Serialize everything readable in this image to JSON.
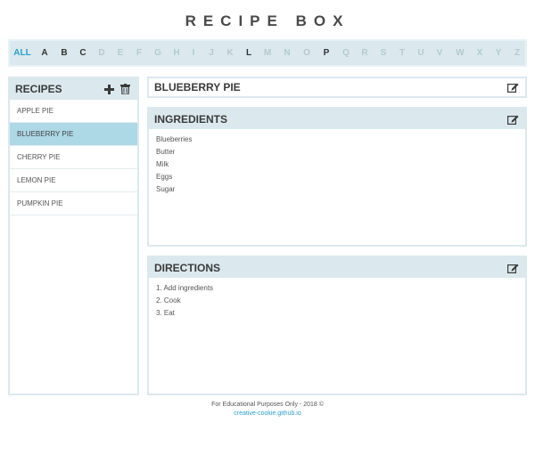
{
  "app": {
    "title": "RECIPE BOX"
  },
  "alphabet": {
    "items": [
      {
        "label": "ALL",
        "state": "active"
      },
      {
        "label": "A",
        "state": "has"
      },
      {
        "label": "B",
        "state": "has"
      },
      {
        "label": "C",
        "state": "has"
      },
      {
        "label": "D",
        "state": "empty"
      },
      {
        "label": "E",
        "state": "empty"
      },
      {
        "label": "F",
        "state": "empty"
      },
      {
        "label": "G",
        "state": "empty"
      },
      {
        "label": "H",
        "state": "empty"
      },
      {
        "label": "I",
        "state": "empty"
      },
      {
        "label": "J",
        "state": "empty"
      },
      {
        "label": "K",
        "state": "empty"
      },
      {
        "label": "L",
        "state": "has"
      },
      {
        "label": "M",
        "state": "empty"
      },
      {
        "label": "N",
        "state": "empty"
      },
      {
        "label": "O",
        "state": "empty"
      },
      {
        "label": "P",
        "state": "has"
      },
      {
        "label": "Q",
        "state": "empty"
      },
      {
        "label": "R",
        "state": "empty"
      },
      {
        "label": "S",
        "state": "empty"
      },
      {
        "label": "T",
        "state": "empty"
      },
      {
        "label": "U",
        "state": "empty"
      },
      {
        "label": "V",
        "state": "empty"
      },
      {
        "label": "W",
        "state": "empty"
      },
      {
        "label": "X",
        "state": "empty"
      },
      {
        "label": "Y",
        "state": "empty"
      },
      {
        "label": "Z",
        "state": "empty"
      }
    ]
  },
  "recipes": {
    "header": "RECIPES",
    "add_icon": "plus-icon",
    "delete_icon": "trash-icon",
    "items": [
      {
        "label": "APPLE PIE",
        "selected": false
      },
      {
        "label": "BLUEBERRY PIE",
        "selected": true
      },
      {
        "label": "CHERRY PIE",
        "selected": false
      },
      {
        "label": "LEMON PIE",
        "selected": false
      },
      {
        "label": "PUMPKIN PIE",
        "selected": false
      }
    ]
  },
  "recipe": {
    "title": "BLUEBERRY PIE",
    "ingredients": {
      "header": "INGREDIENTS",
      "items": [
        "Blueberries",
        "Butter",
        "Milk",
        "Eggs",
        "Sugar"
      ]
    },
    "directions": {
      "header": "DIRECTIONS",
      "items": [
        "1. Add ingredients",
        "2. Cook",
        "3. Eat"
      ]
    }
  },
  "footer": {
    "text": "For Educational Purposes Only - 2018 ©",
    "link": "creative-cookie.github.io"
  },
  "colors": {
    "header_bg": "#dbe9ee",
    "selected_bg": "#add8e6",
    "accent": "#2b9ed0"
  }
}
